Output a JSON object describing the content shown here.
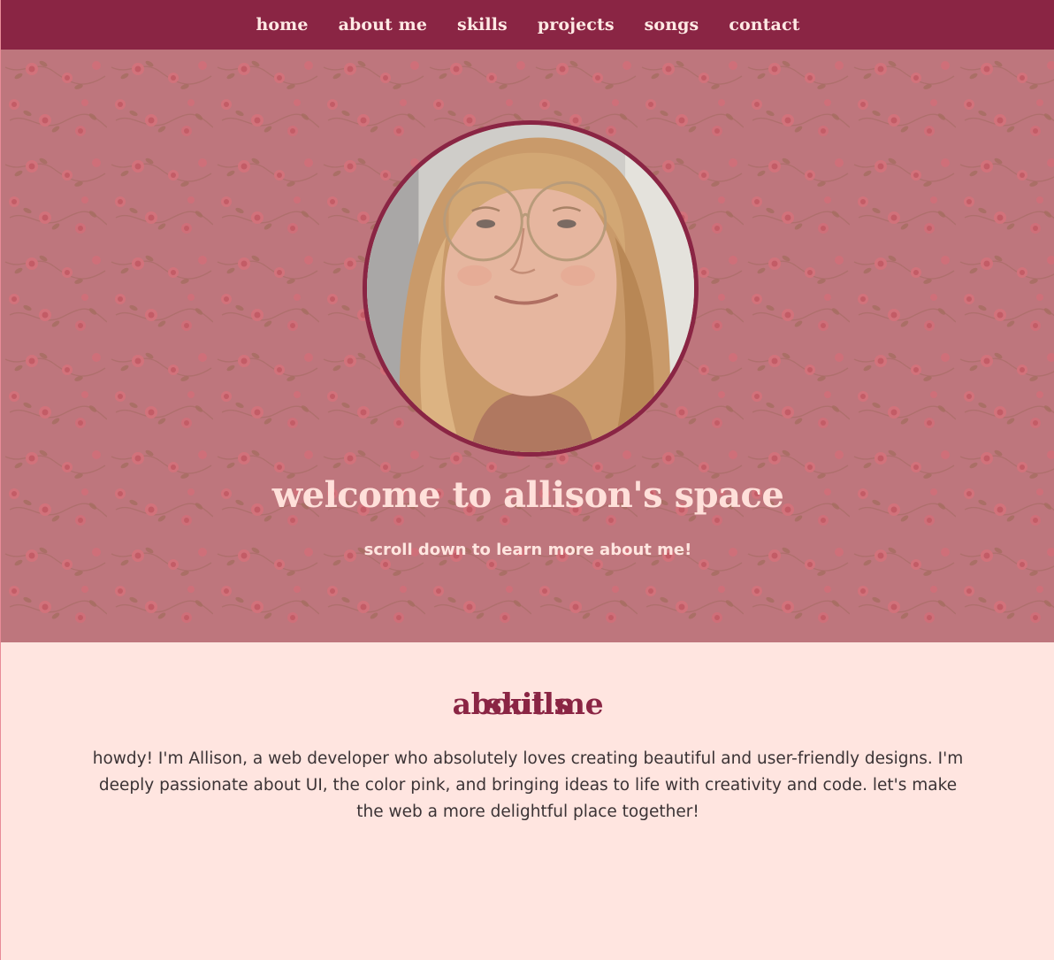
{
  "nav": {
    "items": [
      {
        "label": "home"
      },
      {
        "label": "about me"
      },
      {
        "label": "skills"
      },
      {
        "label": "projects"
      },
      {
        "label": "songs"
      },
      {
        "label": "contact"
      }
    ]
  },
  "hero": {
    "title": "welcome to allison's space",
    "subtitle": "scroll down to learn more about me!"
  },
  "about": {
    "heading": "about me",
    "text": "howdy! I'm Allison, a web developer who absolutely loves creating beautiful and user-friendly designs. I'm deeply passionate about UI, the color pink, and bringing ideas to life with creativity and code. let's make the web a more delightful place together!"
  },
  "skills": {
    "heading": "skills"
  },
  "colors": {
    "brand": "#8a2544",
    "hero_bg": "#be767d",
    "page_bg": "#ffe5e0",
    "text": "#3b3335"
  }
}
